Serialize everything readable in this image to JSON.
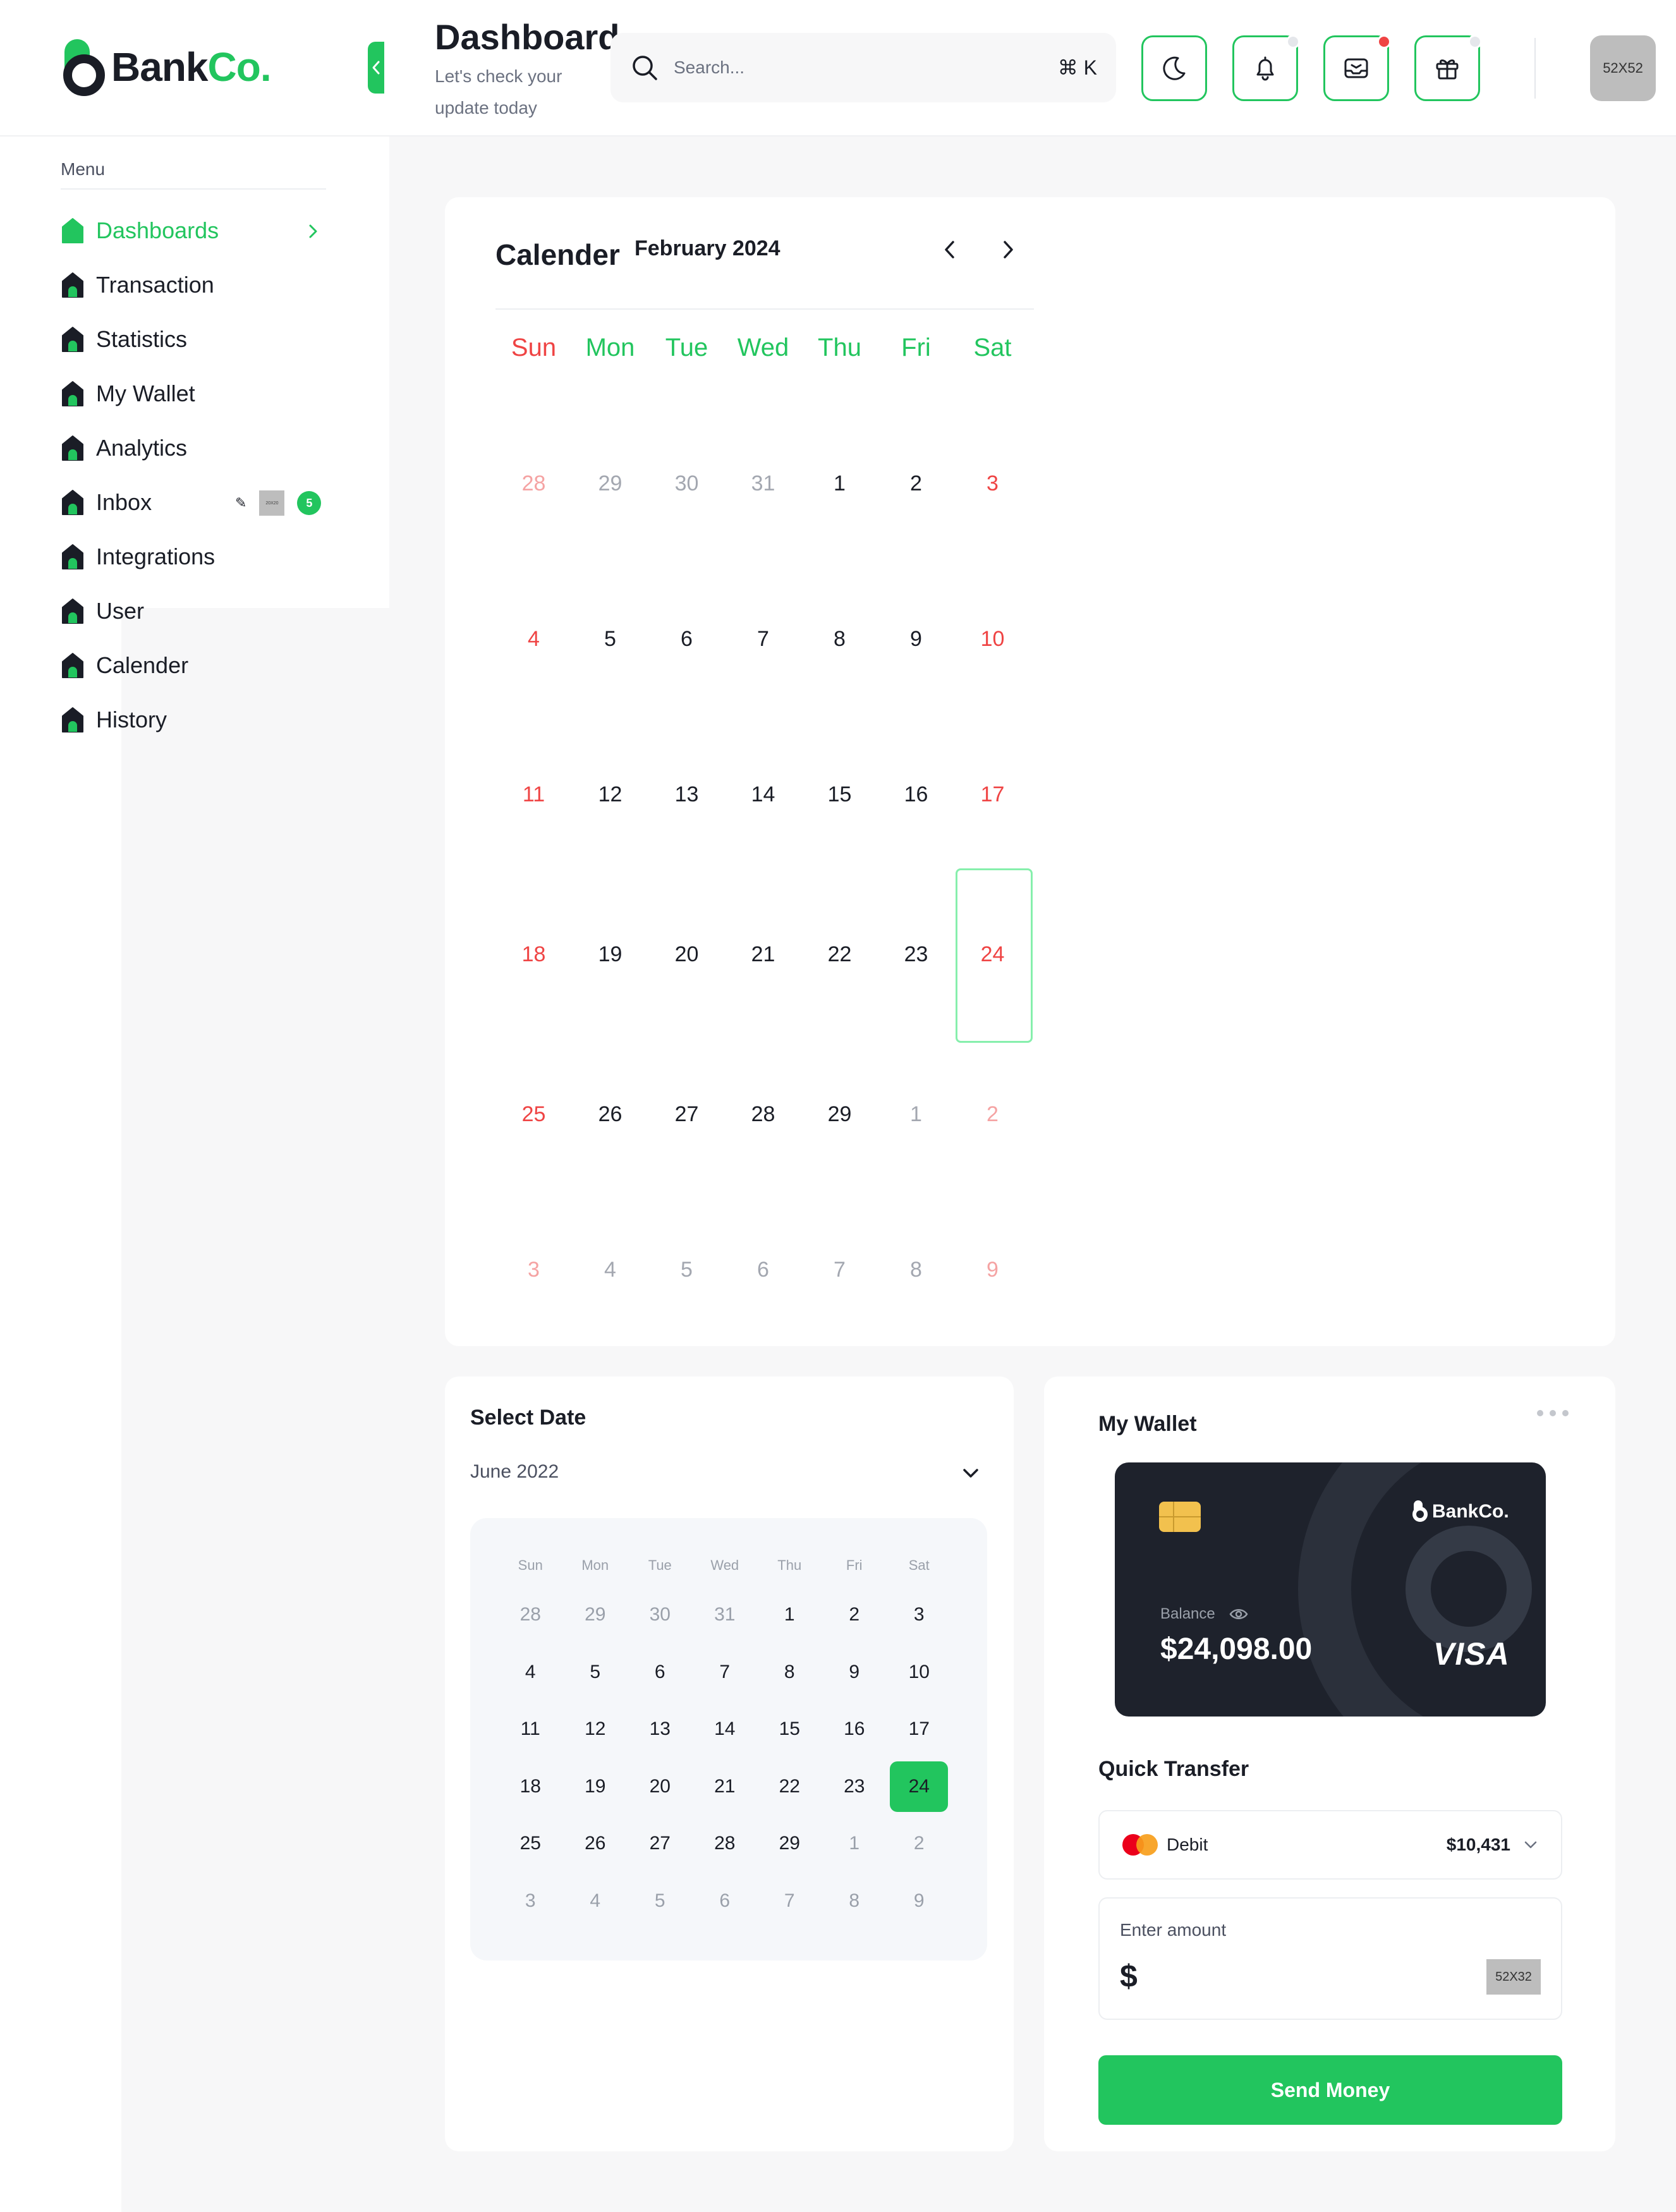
{
  "brand": {
    "name_dark": "Bank",
    "name_green": "Co."
  },
  "header": {
    "title": "Dashboard",
    "subtitle": "Let's check your update today",
    "search_placeholder": "Search...",
    "search_shortcut": "⌘ K",
    "avatar_label": "52X52",
    "buttons": [
      {
        "name": "theme-toggle",
        "icon": "moon-icon",
        "dot": false
      },
      {
        "name": "notifications",
        "icon": "bell-icon",
        "dot": true,
        "dot_color": "#e5e7eb"
      },
      {
        "name": "messages",
        "icon": "mail-icon",
        "dot": true,
        "dot_color": "#ef4444"
      },
      {
        "name": "gifts",
        "icon": "gift-icon",
        "dot": true,
        "dot_color": "#e5e7eb"
      }
    ]
  },
  "sidebar": {
    "menu_label": "Menu",
    "items": [
      {
        "label": "Dashboards",
        "active": true
      },
      {
        "label": "Transaction",
        "active": false
      },
      {
        "label": "Statistics",
        "active": false
      },
      {
        "label": "My Wallet",
        "active": false
      },
      {
        "label": "Analytics",
        "active": false
      },
      {
        "label": "Inbox",
        "active": false,
        "badge": "5",
        "thumb_label": "20X20"
      },
      {
        "label": "Integrations",
        "active": false
      },
      {
        "label": "User",
        "active": false
      },
      {
        "label": "Calender",
        "active": false
      },
      {
        "label": "History",
        "active": false
      }
    ]
  },
  "calendar": {
    "title": "Calender",
    "month": "February 2024",
    "weekdays": [
      "Sun",
      "Mon",
      "Tue",
      "Wed",
      "Thu",
      "Fri",
      "Sat"
    ],
    "selected": "24",
    "weeks": [
      [
        [
          "28",
          true
        ],
        [
          "29",
          true
        ],
        [
          "30",
          true
        ],
        [
          "31",
          true
        ],
        [
          "1",
          false
        ],
        [
          "2",
          false
        ],
        [
          "3",
          false
        ]
      ],
      [
        [
          "4",
          false
        ],
        [
          "5",
          false
        ],
        [
          "6",
          false
        ],
        [
          "7",
          false
        ],
        [
          "8",
          false
        ],
        [
          "9",
          false
        ],
        [
          "10",
          false
        ]
      ],
      [
        [
          "11",
          false
        ],
        [
          "12",
          false
        ],
        [
          "13",
          false
        ],
        [
          "14",
          false
        ],
        [
          "15",
          false
        ],
        [
          "16",
          false
        ],
        [
          "17",
          false
        ]
      ],
      [
        [
          "18",
          false
        ],
        [
          "19",
          false
        ],
        [
          "20",
          false
        ],
        [
          "21",
          false
        ],
        [
          "22",
          false
        ],
        [
          "23",
          false
        ],
        [
          "24",
          false
        ]
      ],
      [
        [
          "25",
          false
        ],
        [
          "26",
          false
        ],
        [
          "27",
          false
        ],
        [
          "28",
          false
        ],
        [
          "29",
          false
        ],
        [
          "1",
          true
        ],
        [
          "2",
          true
        ]
      ],
      [
        [
          "3",
          true
        ],
        [
          "4",
          true
        ],
        [
          "5",
          true
        ],
        [
          "6",
          true
        ],
        [
          "7",
          true
        ],
        [
          "8",
          true
        ],
        [
          "9",
          true
        ]
      ]
    ]
  },
  "select_date": {
    "title": "Select Date",
    "month": "June 2022",
    "weekdays": [
      "Sun",
      "Mon",
      "Tue",
      "Wed",
      "Thu",
      "Fri",
      "Sat"
    ],
    "selected": "24",
    "weeks": [
      [
        [
          "28",
          true
        ],
        [
          "29",
          true
        ],
        [
          "30",
          true
        ],
        [
          "31",
          true
        ],
        [
          "1",
          false
        ],
        [
          "2",
          false
        ],
        [
          "3",
          false
        ]
      ],
      [
        [
          "4",
          false
        ],
        [
          "5",
          false
        ],
        [
          "6",
          false
        ],
        [
          "7",
          false
        ],
        [
          "8",
          false
        ],
        [
          "9",
          false
        ],
        [
          "10",
          false
        ]
      ],
      [
        [
          "11",
          false
        ],
        [
          "12",
          false
        ],
        [
          "13",
          false
        ],
        [
          "14",
          false
        ],
        [
          "15",
          false
        ],
        [
          "16",
          false
        ],
        [
          "17",
          false
        ]
      ],
      [
        [
          "18",
          false
        ],
        [
          "19",
          false
        ],
        [
          "20",
          false
        ],
        [
          "21",
          false
        ],
        [
          "22",
          false
        ],
        [
          "23",
          false
        ],
        [
          "24",
          false
        ]
      ],
      [
        [
          "25",
          false
        ],
        [
          "26",
          false
        ],
        [
          "27",
          false
        ],
        [
          "28",
          false
        ],
        [
          "29",
          false
        ],
        [
          "1",
          true
        ],
        [
          "2",
          true
        ]
      ],
      [
        [
          "3",
          true
        ],
        [
          "4",
          true
        ],
        [
          "5",
          true
        ],
        [
          "6",
          true
        ],
        [
          "7",
          true
        ],
        [
          "8",
          true
        ],
        [
          "9",
          true
        ]
      ]
    ]
  },
  "wallet": {
    "title": "My Wallet",
    "card_brand": "BankCo.",
    "balance_label": "Balance",
    "balance": "$24,098.00",
    "network": "VISA"
  },
  "quick_transfer": {
    "title": "Quick Transfer",
    "account_type": "Debit",
    "account_balance": "$10,431",
    "amount_label": "Enter amount",
    "currency_symbol": "$",
    "amount_value": "",
    "thumb_label": "52X32",
    "send_label": "Send Money"
  },
  "colors": {
    "accent": "#22c55e",
    "danger": "#ef4444",
    "dark": "#1a1d26"
  }
}
